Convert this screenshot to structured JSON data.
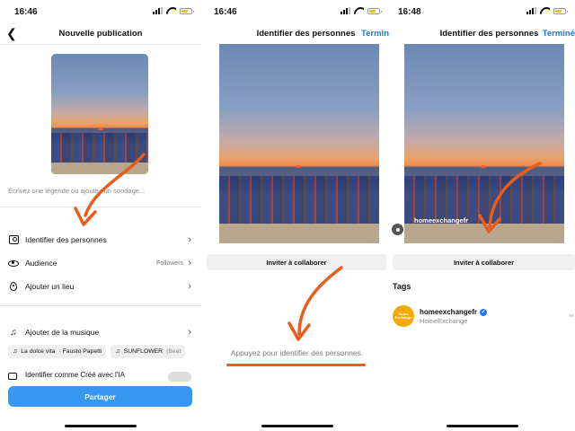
{
  "screens": [
    {
      "status_time": "16:46",
      "header": {
        "back_icon": "chevron-left-icon",
        "title": "Nouvelle publication"
      },
      "caption_placeholder": "Écrivez une légende ou ajoutez un sondage...",
      "rows": [
        {
          "icon": "person-tag-icon",
          "label": "Identifier des personnes",
          "value": ""
        },
        {
          "icon": "eye-icon",
          "label": "Audience",
          "value": "Followers"
        },
        {
          "icon": "location-pin-icon",
          "label": "Ajouter un lieu",
          "value": ""
        },
        {
          "icon": "music-icon",
          "label": "Ajouter de la musique",
          "value": ""
        }
      ],
      "music_chips": [
        {
          "song": "La dolce vita",
          "artist": "· Fausto Papetti"
        },
        {
          "song": "SUNFLOWER",
          "artist": "(Beat"
        }
      ],
      "ai_label": "Identifier comme Créé avec l'IA",
      "share_label": "Partager"
    },
    {
      "status_time": "16:46",
      "header": {
        "title": "Identifier des personnes",
        "done": "Termin"
      },
      "collab_label": "Inviter à collaborer",
      "tap_hint": "Appuyez pour identifier des personnes."
    },
    {
      "status_time": "16:48",
      "header": {
        "title": "Identifier des personnes",
        "done": "Terminé"
      },
      "photo_tag": "homeexchangefr",
      "collab_label": "Inviter à collaborer",
      "tags_heading": "Tags",
      "tagged_account": {
        "username": "homeexchangefr",
        "display_name": "HomeExchange",
        "logo_text": "Home Exchange",
        "verified": true
      }
    }
  ],
  "colors": {
    "accent_blue": "#1877f2",
    "share_button": "#3897f0",
    "annotation_orange": "#e85d1c",
    "battery": "#f3c400"
  }
}
